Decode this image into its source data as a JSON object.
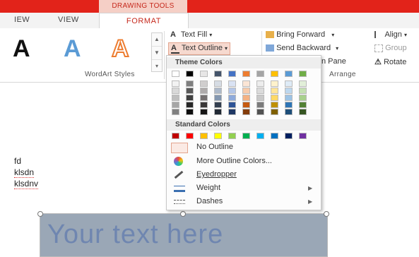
{
  "context_tab": {
    "label": "DRAWING TOOLS"
  },
  "tabs": {
    "view1": "IEW",
    "view2": "VIEW",
    "format": "FORMAT"
  },
  "wordart": {
    "letters": [
      "A",
      "A",
      "A"
    ],
    "group_label": "WordArt Styles"
  },
  "shape_format": {
    "text_fill": "Text Fill",
    "text_outline": "Text Outline"
  },
  "arrange": {
    "bring_forward": "Bring Forward",
    "send_backward": "Send Backward",
    "pane": "n Pane",
    "align": "Align",
    "group": "Group",
    "rotate": "Rotate",
    "group_label": "Arrange"
  },
  "menu": {
    "theme_header": "Theme Colors",
    "standard_header": "Standard Colors",
    "theme_top": [
      "#ffffff",
      "#000000",
      "#e7e6e6",
      "#44546a",
      "#4472c4",
      "#ed7d31",
      "#a5a5a5",
      "#ffc000",
      "#5b9bd5",
      "#70ad47"
    ],
    "theme_columns": [
      [
        "#f2f2f2",
        "#d9d9d9",
        "#bfbfbf",
        "#a6a6a6",
        "#808080"
      ],
      [
        "#7f7f7f",
        "#595959",
        "#404040",
        "#262626",
        "#0d0d0d"
      ],
      [
        "#d0cece",
        "#aeabab",
        "#757171",
        "#3a3838",
        "#171616"
      ],
      [
        "#d6dce4",
        "#adb9ca",
        "#8497b0",
        "#333f4f",
        "#222a35"
      ],
      [
        "#d9e2f3",
        "#b4c6e7",
        "#8eaadb",
        "#2f5496",
        "#1f3864"
      ],
      [
        "#fbe5d5",
        "#f7cbac",
        "#f4b183",
        "#c55a11",
        "#833c0b"
      ],
      [
        "#ededed",
        "#dbdbdb",
        "#c9c9c9",
        "#7b7b7b",
        "#525252"
      ],
      [
        "#fff2cc",
        "#ffe599",
        "#ffd966",
        "#bf9000",
        "#7f6000"
      ],
      [
        "#deebf6",
        "#bdd7ee",
        "#9cc3e5",
        "#2e75b5",
        "#1e4e79"
      ],
      [
        "#e2efd9",
        "#c5e0b3",
        "#a8d08d",
        "#538135",
        "#375623"
      ]
    ],
    "standard": [
      "#c00000",
      "#ff0000",
      "#ffc000",
      "#ffff00",
      "#92d050",
      "#00b050",
      "#00b0f0",
      "#0070c0",
      "#002060",
      "#7030a0"
    ],
    "no_outline": "No Outline",
    "more_colors": "More Outline Colors...",
    "eyedropper": "Eyedropper",
    "weight": "Weight",
    "dashes": "Dashes"
  },
  "document": {
    "lines": [
      "fd",
      "klsdn",
      "klsdnv"
    ],
    "wordart_text": "Your text here"
  }
}
